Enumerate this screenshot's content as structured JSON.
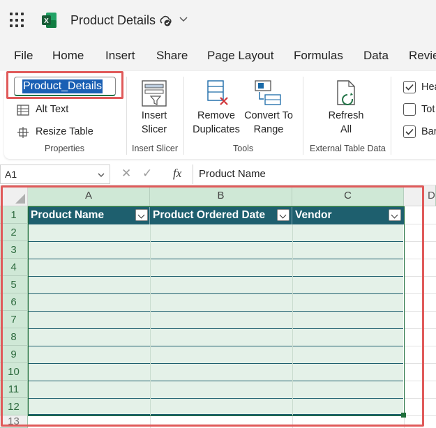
{
  "app": {
    "title": "Product Details",
    "brand_color": "#217346"
  },
  "menu": [
    "File",
    "Home",
    "Insert",
    "Share",
    "Page Layout",
    "Formulas",
    "Data",
    "Revie"
  ],
  "ribbon": {
    "table_name": "Product_Details",
    "alt_text": "Alt Text",
    "resize_table": "Resize Table",
    "group_properties": "Properties",
    "insert_slicer_line1": "Insert",
    "insert_slicer_line2": "Slicer",
    "group_insert_slicer": "Insert Slicer",
    "remove_dup_line1": "Remove",
    "remove_dup_line2": "Duplicates",
    "convert_line1": "Convert To",
    "convert_line2": "Range",
    "group_tools": "Tools",
    "refresh_line1": "Refresh",
    "refresh_line2": "All",
    "group_external": "External Table Data",
    "opt_header": "Hea",
    "opt_total": "Tot",
    "opt_banded": "Bar"
  },
  "formula_bar": {
    "cell_ref": "A1",
    "cancel": "✕",
    "enter": "✓",
    "fx": "fx",
    "value": "Product Name"
  },
  "sheet": {
    "columns": [
      "A",
      "B",
      "C",
      "D"
    ],
    "rows": [
      "1",
      "2",
      "3",
      "4",
      "5",
      "6",
      "7",
      "8",
      "9",
      "10",
      "11",
      "12",
      "13"
    ],
    "table_headers": [
      "Product Name",
      "Product Ordered Date",
      "Vendor"
    ],
    "table_header_color": "#1e5f6e",
    "table_band_color": "#e4f1e8"
  }
}
